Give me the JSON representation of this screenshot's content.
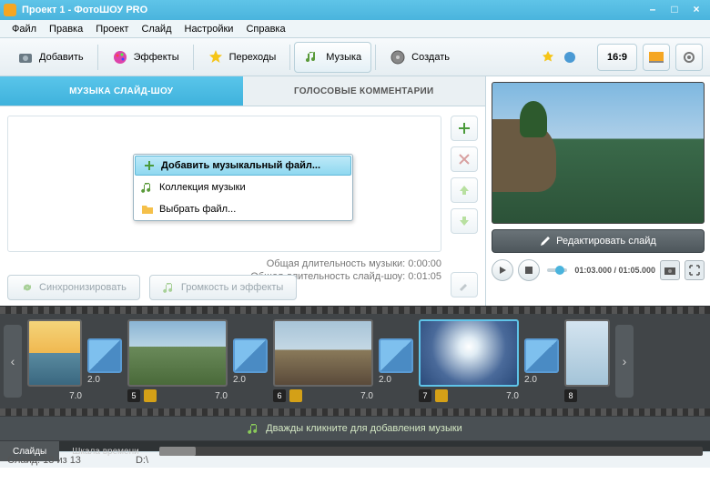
{
  "title": "Проект 1 - ФотоШОУ PRO",
  "menu": [
    "Файл",
    "Правка",
    "Проект",
    "Слайд",
    "Настройки",
    "Справка"
  ],
  "toolbar": {
    "add": "Добавить",
    "effects": "Эффекты",
    "transitions": "Переходы",
    "music": "Музыка",
    "create": "Создать",
    "ratio": "16:9"
  },
  "subtabs": {
    "music": "МУЗЫКА СЛАЙД-ШОУ",
    "voice": "ГОЛОСОВЫЕ КОММЕНТАРИИ"
  },
  "dropdown": {
    "add": "Добавить музыкальный файл...",
    "collection": "Коллекция музыки",
    "choose": "Выбрать файл..."
  },
  "duration": {
    "music": "Общая длительность музыки: 0:00:00",
    "slideshow": "Общая длительность слайд-шоу: 0:01:05"
  },
  "buttons": {
    "sync": "Синхронизировать",
    "volume": "Громкость и эффекты",
    "edit": "Редактировать слайд"
  },
  "playback": {
    "time": "01:03.000 / 01:05.000"
  },
  "slides": [
    {
      "n": "",
      "dur": "7.0",
      "tdur": "2.0"
    },
    {
      "n": "5",
      "dur": "7.0",
      "tdur": "2.0"
    },
    {
      "n": "6",
      "dur": "7.0",
      "tdur": "2.0"
    },
    {
      "n": "7",
      "dur": "7.0",
      "tdur": "2.0"
    },
    {
      "n": "8",
      "dur": "",
      "tdur": ""
    }
  ],
  "musictrack": "Дважды кликните для добавления музыки",
  "tltabs": {
    "slides": "Слайды",
    "timeline": "Шкала времени"
  },
  "status": {
    "count": "Слайд: 13 из 13",
    "path": "D:\\"
  }
}
